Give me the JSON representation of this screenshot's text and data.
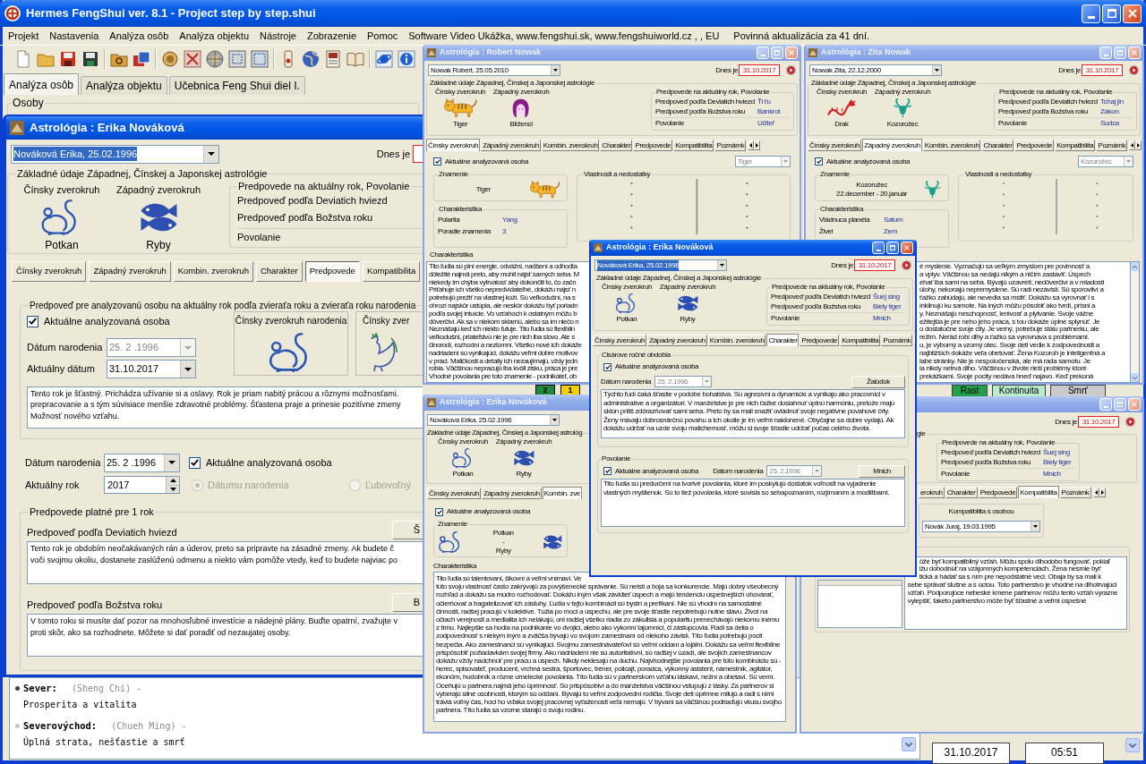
{
  "app": {
    "title": "Hermes FengShui ver. 8.1 - Project step by step.shui",
    "menu": [
      "Projekt",
      "Nastavenia",
      "Analýza osôb",
      "Analýza objektu",
      "Nástroje",
      "Zobrazenie",
      "Pomoc",
      "Software Video Ukážka, www.fengshui.sk, www.fengshuiworld.cz , , EU"
    ],
    "notice": "Povinná aktualizácia za 41 dní.",
    "tabs": [
      {
        "label": "Analýza osôb",
        "selected": true
      },
      {
        "label": "Analýza objektu",
        "selected": false
      },
      {
        "label": "Učebnica Feng Shui diel I.",
        "selected": false
      }
    ],
    "group_label": "Osoby",
    "directions": [
      {
        "name": "Sever:",
        "alias": "(Sheng Chi) -",
        "meaning": "Prosperita a vitalita",
        "color": "#404040"
      },
      {
        "name": "Severovýchod:",
        "alias": "(Chueh Ming) -",
        "meaning": "Úplná strata, nešťastie a smrť",
        "color": "#c4c4c4"
      }
    ],
    "status": {
      "date": "31.10.2017",
      "time": "05:51"
    }
  },
  "main_window": {
    "title": "Astrológia : Erika Nováková",
    "active": true,
    "person": {
      "value": "Nováková Erika, 25.02.1996",
      "highlighted": true
    },
    "today_label": "Dnes je",
    "basics_label": "Základné údaje Západnej, Čínskej a Japonskej astrológie",
    "signs": [
      {
        "label": "Čínsky zverokruh",
        "kind": "rat",
        "name": "Potkan"
      },
      {
        "label": "Západný zverokruh",
        "kind": "fish",
        "name": "Ryby"
      }
    ],
    "forecast_label": "Predpovede na aktuálny rok, Povolanie",
    "forecast_rows": [
      "Predpoveď podľa Deviatich hviezd",
      "Predpoveď podľa Božstva roku",
      "Povolanie"
    ],
    "tabs": [
      {
        "label": "Čínsky zverokruh",
        "selected": false
      },
      {
        "label": "Západný zverokruh",
        "selected": false
      },
      {
        "label": "Kombin. zverokruh",
        "selected": false
      },
      {
        "label": "Charakter",
        "selected": false
      },
      {
        "label": "Predpovede",
        "selected": true
      },
      {
        "label": "Kompatibilita",
        "selected": false
      }
    ],
    "year_group": {
      "label": "Predpoveď pre analyzovanú osobu na aktuálny rok podľa zvieraťa roku a zvieraťa roku narodenia",
      "current_person": {
        "label": "Aktuálne analyzovaná osoba",
        "checked": true
      },
      "birth": {
        "label": "Dátum narodenia",
        "value": "25. 2 .1996",
        "disabled": true
      },
      "date": {
        "label": "Aktuálny dátum",
        "value": "31.10.2017",
        "disabled": false
      },
      "animals": [
        {
          "label": "Čínsky zverokruh narodenia",
          "kind": "rat"
        },
        {
          "label": "Čínsky zver",
          "kind": "rooster"
        }
      ],
      "text_lines": [
        "Tento rok je šťastný. Prichádza užívanie si a oslavy. Rok je priam nabitý prácou a rôznymi možnosťami.",
        "prepracovanie a s tým súvisiace menšie zdravotné problémy. Šťastena praje a prinesie pozitívne zmeny",
        "Možnosť nového vzťahu."
      ]
    },
    "birth": {
      "label": "Dátum narodenia",
      "value": "25. 2 .1996"
    },
    "current_person": {
      "label": "Aktuálne analyzovaná osoba",
      "checked": true
    },
    "year": {
      "label": "Aktuálny rok",
      "value": "2017"
    },
    "modes": [
      {
        "label": "Dátumu narodenia",
        "selected": true,
        "disabled": true
      },
      {
        "label": "Ľubovoľný",
        "selected": false,
        "disabled": true
      }
    ],
    "one_year": {
      "label": "Predpovede platné pre 1 rok",
      "items": [
        {
          "label": "Predpoveď podľa Deviatich hviezd",
          "button": "Š",
          "text_lines": [
            "Tento rok je obdobím neočakávaných rán a úderov, preto sa pripravte na zásadné zmeny. Ak budete č",
            "voči svojmu okoliu, dostanete zaslúženú odmenu a niekto vám pomôže vtedy, keď to budete najviac po"
          ]
        },
        {
          "label": "Predpoveď podľa Božstva roku",
          "button": "B",
          "text_lines": [
            "V tomto roku si musíte dať pozor na mnohosľubné investície a nádejné plány. Buďte opatrní, zvažujte v",
            "proti skôr, ako sa rozhodnete. Môžete si dať poradiť od nezaujatej osoby."
          ]
        }
      ]
    },
    "number_cells": [
      {
        "label": "2",
        "color": "#1f8a3c"
      },
      {
        "label": "1",
        "color": "#f2d000"
      }
    ],
    "phases": [
      {
        "label": "Rast",
        "color": "#23a04c"
      },
      {
        "label": "Kontinuita",
        "color": "#b9eccb"
      },
      {
        "label": "Smrť",
        "color": "#c9c9c9"
      }
    ]
  },
  "robert_window": {
    "title": "Astrológia : Robert Nowak",
    "active": false,
    "person": {
      "value": "Nowak Robert, 25.05.2010",
      "highlighted": false
    },
    "today_label": "Dnes je",
    "today": "31.10.2017",
    "basics_label": "Základné údaje Západnej, Čínskej a Japonskej astrológie",
    "signs": [
      {
        "label": "Čínsky zverokruh",
        "kind": "tiger",
        "name": "Tiger"
      },
      {
        "label": "Západný zverokruh",
        "kind": "twins",
        "name": "Blíženci"
      }
    ],
    "forecast_label": "Predpovede na aktuálny rok, Povolanie",
    "forecasts": [
      {
        "label": "Predpoveď podľa Deviatich hviezd",
        "value": "Ťi ťu"
      },
      {
        "label": "Predpoveď podľa Božstva roku",
        "value": "Bankrot"
      },
      {
        "label": "Povolanie",
        "value": "Učiteľ"
      }
    ],
    "tabs": [
      {
        "label": "Čínsky zverokruh",
        "selected": true
      },
      {
        "label": "Západný zverokruh",
        "selected": false
      },
      {
        "label": "Kombin. zverokruh",
        "selected": false
      },
      {
        "label": "Charakter",
        "selected": false
      },
      {
        "label": "Predpovede",
        "selected": false
      },
      {
        "label": "Kompatibilita",
        "selected": false
      },
      {
        "label": "Poznámk",
        "selected": false
      }
    ],
    "current_person": {
      "label": "Aktuálne analyzovaná osoba",
      "checked": true
    },
    "sign_select": {
      "value": "Tiger",
      "disabled": true
    },
    "sign_group": {
      "label": "Znamenie",
      "name": "Tiger",
      "kind": "tiger"
    },
    "traits_group": {
      "label": "Charakteristika",
      "rows": [
        {
          "label": "Polarita",
          "value": "Yang"
        },
        {
          "label": "Poradie znamenia",
          "value": "3"
        }
      ]
    },
    "qualities_label": "Vlastnosti a nedostatky",
    "text_label": "Charakteristika",
    "text_lines": [
      "Tito ľudia sú plní energie, odvážni, nadšení a odhodla",
      "dôležité najmä preto, aby mohli nájsť samých seba. M",
      "niekedy im chýba vytrvalosť aby dokončili to, čo začn",
      "Priťahuje ich všetko nepredvídateľné, dokážu nájsť n",
      "potrebujú prežiť na vlastnej koži. Sú veľkodušní, na s",
      "ohrozí najskôr ustúpia, ale neskôr dokážu byť poriadn",
      "podľa svojej intuície. Vo vzťahoch k ostatným môžu b",
      "dôverčiví. Ak sa v niekom sklamú, alebo sa im niečo n",
      "Neznášajú keď ich niekto ľutuje. Tito ľudia sú flexibiln",
      "veľkodušní, priateľstvo nie je pre nich iba slovo. Ale s",
      "činorodí, rozhodní a nezlomní. Všetko nové ich dokáže",
      "nadriadení sú vynikajúci, dokážu veľmi dobre motivov",
      "v práci. Maličkosti a detaily ich nezaujímajú, vždy jedn",
      "robia. Väčšinou nepracujú iba kvôli zisku, práca je pre",
      "Vhodné povolania pre toto znamenie - podnikateľ, ob"
    ]
  },
  "zita_window": {
    "title": "Astrológia : Zita Nowak",
    "active": false,
    "person": {
      "value": "Nowak Zita, 22.12.2000",
      "highlighted": false
    },
    "today_label": "Dnes je",
    "today": "31.10.2017",
    "basics_label": "Základné údaje Západnej, Čínskej a Japonskej astrológie",
    "signs": [
      {
        "label": "Čínsky zverokruh",
        "kind": "dragon",
        "name": "Drak"
      },
      {
        "label": "Západný zverokruh",
        "kind": "capricorn",
        "name": "Kozorožec"
      }
    ],
    "forecast_label": "Predpovede na aktuálny rok, Povolanie",
    "forecasts": [
      {
        "label": "Predpoveď podľa Deviatich hviezd",
        "value": "Tchaj jin"
      },
      {
        "label": "Predpoveď podľa Božstva roku",
        "value": "Zákon"
      },
      {
        "label": "Povolanie",
        "value": "Sudca"
      }
    ],
    "tabs": [
      {
        "label": "Čínsky zverokruh",
        "selected": false
      },
      {
        "label": "Západný zverokruh",
        "selected": true
      },
      {
        "label": "Kombin. zverokruh",
        "selected": false
      },
      {
        "label": "Charakter",
        "selected": false
      },
      {
        "label": "Predpovede",
        "selected": false
      },
      {
        "label": "Kompatibilita",
        "selected": false
      },
      {
        "label": "Poznámk",
        "selected": false
      }
    ],
    "current_person": {
      "label": "Aktuálne analyzovaná osoba",
      "checked": true
    },
    "sign_select": {
      "value": "Kozorožec",
      "disabled": true
    },
    "sign_group": {
      "label": "Znamenie",
      "name": "Kozorožec",
      "range": "22.december - 20.január",
      "kind": "capricorn"
    },
    "traits_group": {
      "label": "Charakteristika",
      "rows": [
        {
          "label": "Vládnuca planéta",
          "value": "Saturn"
        },
        {
          "label": "Živel",
          "value": "Zem"
        }
      ]
    },
    "qualities_label": "Vlastnosti a nedostatky",
    "text_lines": [
      "é myslenie. Vyznačujú sa veľkým zmyslom pre povinnosť a",
      "a vplyv. Väčšinou sa nedajú nikým a ničím zastaviť. Úspech",
      "ehať iba sami na seba. Bývajú uzavretí, nedôverčiví a v mladosti",
      "úlohy, nekonajú nepremyslene. Sú radi nezávislí. Sú sporovliví a",
      "ťažko zabúdajú, ale nevedia sa mstiť. Dokážu sa vyrovnať i s",
      "inklinujú ku samote. Na iných môžu pôsobiť ako tvrdí, prísni a",
      "y. Neznášajú neschopnosť, lenivosť a plytvanie. Svoje vážne",
      "ežitejšia je pre neho jeho práca, s tou dokáže úplne splynúť. Je",
      "o dostatočne svoje city. Je verný, potrebuje stálu partnerku, ale",
      "režim. Nerád robí dlhy a ťažko sa vyrovnáva s problémami.",
      "u, je výborný a vzorný otec. Svoje deti vedie k zodpovednosti a",
      "najbližších dokáže veľa obetovať. Žena Kozoroh je inteligentná a",
      "labé stránky. Nie je nespoločenská, ale má rada samotu. Je",
      "ia nikdy netrvá dlho. Väčšinou v živote rieši problémy ktoré",
      "prekážkami. Svoje pocity nedáva hneď najavo. Keď prekoná"
    ]
  },
  "erika_bottom_window": {
    "title": "Astrológia : Erika Nováková",
    "active": false,
    "person": {
      "value": "Nováková Erika, 25.02.1996",
      "highlighted": false
    },
    "basics_label": "Základné údaje Západnej, Čínskej a Japonskej astrológ",
    "signs": [
      {
        "label": "Čínsky zverokruh",
        "kind": "rat",
        "name": "Potkan"
      },
      {
        "label": "Západný zverokruh",
        "kind": "fish",
        "name": "Ryby"
      }
    ],
    "tabs": [
      {
        "label": "Čínsky zverokruh",
        "selected": false
      },
      {
        "label": "Západný zverokruh",
        "selected": false
      },
      {
        "label": "Kombin. zve",
        "selected": true
      }
    ],
    "current_person": {
      "label": "Aktuálne analyzovaná osoba",
      "checked": true
    },
    "sign_group": {
      "label": "Znamenie",
      "signs": [
        {
          "kind": "rat",
          "name": "Potkan"
        },
        {
          "kind": "fish",
          "name": "Ryby"
        }
      ],
      "separator": "-"
    },
    "text_label": "Charakteristika",
    "text_first_line": "Tito ľudia sú talentovaní, šikovní a veľmi vnímaví. Ve",
    "text": "túto svoju vlastnosť často zakrývajú za povýšenecké správanie. Sú neistí a boja sa konkurencie. Majú dobrý všeobecný rozhľad a dokážu sa múdro rozhodovať. Dokážu iným však závidieť úspech a majú tendenciu úspešnejších ohovárať, očierňovať a bagatelizovať ich zásluhy. Ľudia v tejto kombinácii sú bystrí a prefíkaní. Nie sú vhodní na samostatné činnosti, radšej pracujú v kolektíve. Túžia po moci a úspechu, ale pre svoje šťastie nepotrebujú nutne slávu. Život na očiach verejnosti a medialita ich nelákajú, oni radšej všetko riadia zo zákulisia a popularitu prenechávajú niekomu inému z tímu. Najlepšie sa hodia na podnikanie vo dvojici, alebo ako výkonní tajomníci, či zástupcovia. Radi sa delia o zodpovednosť s niekým iným a zväčša bývajú vo svojom zamestnaní od niekoho závislí. Títo ľudia potrebujú pocit bezpečia. Ako zamestnanci sú vynikajúci. Svojmu zamestnávateľovi sú veľmi oddaní a lojálni. Dokážu sa veľmi flexibilne prispôsobiť požiadavkám svojej firmy. Ako nadriadení nie sú autoritatívni, sú radšej v úzadí, ale svojich zamestnancov dokážu vždy nadchnúť pre prácu a úspech. Nikdy neklesajú na duchu. Najvhodnejšie povolania pre túto kombináciu sú - herec, spisovateľ, producent, vrchná sestra, športovec, tréner, policajt, poradca, výkonný asistent, námestník, agitátor, ekonóm, hudobník a rôzne umelecké povolania. Títo ľudia sú v partnerskom vzťahu láskaví, nežní a obetaví. Sú verní. Oceňujú u partnera najmä jeho úprimnosť. Sú prispôsobiví a do manželstva väčšinou vstupujú z lásky. Za partnerov si vyberajú silné osobnosti, ktorým sú oddaní. Bývajú to veľmi zodpovední rodičia. Svoje deti úprimne milujú a radi s nimi trávia voľný čas, hoci ho vďaka svojej pracovnej vyťaženosti veľa nemajú. V bývaní sa väčšinou podriaďujú vkusu svojho partnera. Títo ľudia sa vzorne starajú o svoju rodinu."
  },
  "compat_window": {
    "active": false,
    "today_label": "Dnes je",
    "today": "31.10.2017",
    "basics_label": "gie",
    "forecast_label": "Predpovede na aktuálny rok, Povolanie",
    "forecasts": [
      {
        "label": "Predpoveď podľa Deviatich hviezd",
        "value": "Šuej sing"
      },
      {
        "label": "Predpoveď podľa Božstva roku",
        "value": "Biely tiger"
      },
      {
        "label": "Povolanie",
        "value": "Mnich"
      }
    ],
    "tabs": [
      {
        "label": "erokruh",
        "selected": false
      },
      {
        "label": "Charakter",
        "selected": false
      },
      {
        "label": "Predpovede",
        "selected": false
      },
      {
        "label": "Kompatibilita",
        "selected": true
      },
      {
        "label": "Poznámk",
        "selected": false
      }
    ],
    "partner": {
      "label": "Kompatibilita s osobou",
      "value": "Novák Juraj, 19.03.1995"
    },
    "text_cut_lines": [
      "ôže byť kompatibilný vzťah. Môžu spolu dlhodobo fungovať, pokiaľ",
      "ižu dohodnúť na vzájomných kompetenciách. Žena nesmie byť",
      "tická a hádať sa s ním pre nepodstatné veci. Obaja by sa mali k"
    ],
    "text_lines": [
      "sebe správať slušne a s úctou. Toto partnerstvo je vhodné na dlhotrvajúci",
      "vzťah. Podporujúce nebeské kmene partnerov môžu tento vzťah výrazne",
      "vylepšiť, takéto partnerstvo môže byť šťastné a veľmi úspešné"
    ]
  },
  "erika_top_window": {
    "title": "Astrológia : Erika Nováková",
    "active": true,
    "person": {
      "value": "Nováková Erika, 25.02.1996",
      "highlighted": true
    },
    "today_label": "Dnes je",
    "today": "31.10.2017",
    "basics_label": "Základné údaje Západnej, Čínskej a Japonskej astrológie",
    "signs": [
      {
        "label": "Čínsky zverokruh",
        "kind": "rat",
        "name": "Potkan"
      },
      {
        "label": "Západný zverokruh",
        "kind": "fish",
        "name": "Ryby"
      }
    ],
    "forecast_label": "Predpovede na aktuálny rok, Povolanie",
    "forecasts": [
      {
        "label": "Predpoveď podľa Deviatich hviezd",
        "value": "Šuej sing"
      },
      {
        "label": "Predpoveď podľa Božstva roku",
        "value": "Biely tiger"
      },
      {
        "label": "Povolanie",
        "value": "Mnich"
      }
    ],
    "tabs": [
      {
        "label": "Čínsky zverokruh",
        "selected": false
      },
      {
        "label": "Západný zverokruh",
        "selected": false
      },
      {
        "label": "Kombin. zverokruh",
        "selected": false
      },
      {
        "label": "Charakter",
        "selected": true
      },
      {
        "label": "Predpovede",
        "selected": false
      },
      {
        "label": "Kompatibilita",
        "selected": false
      },
      {
        "label": "Poznámk",
        "selected": false
      }
    ],
    "seasons": {
      "label": "Cisárove ročné obdobia",
      "current_person": {
        "label": "Aktuálne analyzovaná osoba",
        "checked": true
      },
      "birth": {
        "label": "Dátum narodenia",
        "value": "25. 2.1996",
        "disabled": true
      },
      "button": "Žalúdok",
      "text": "Týchto ľudí čaká šťastie v podobe bohatstva. Sú agresívni a dynamickí a vynikajú ako pracovníci v administratíve a organizátori. V manželstve je pre nich ťažké dosiahnuť úplnú harmóniu, pretože majú sklon príliš zdôrazňovať sami seba. Preto by sa mali snažiť ovládnuť svoje negatívne povahové črty. Ženy mávajú dobrosrdečnú povahu a ich okolie je im veľmi naklonené. Obyčajne sa dobre vydajú. Ak dokážu udržať na uzde svoju malichernosť, môžu si svoje šťastie udržať počas celého života."
    },
    "career": {
      "label": "Povolanie",
      "current_person": {
        "label": "Aktuálne analyzovaná osoba",
        "checked": true
      },
      "birth": {
        "label": "Dátum narodenia",
        "value": "25. 2.1996",
        "disabled": true
      },
      "button": "Mnich",
      "text": "Tito ľudia sú predurčení na tvorivé povolania, ktoré im poskytujú dostatok voľnosti na vyjadrenie vlastných myšlienok. Sú to tiež povolania, ktoré súvisia so sebapoznaním, rozjímaním a modlitbami."
    }
  }
}
